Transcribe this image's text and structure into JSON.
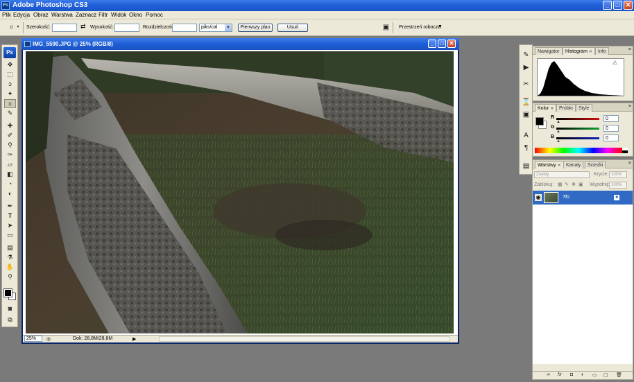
{
  "window": {
    "title": "Adobe Photoshop CS3"
  },
  "menu": [
    "Plik",
    "Edycja",
    "Obraz",
    "Warstwa",
    "Zaznacz",
    "Filtr",
    "Widok",
    "Okno",
    "Pomoc"
  ],
  "options": {
    "width_label": "Szerokość:",
    "width_value": "",
    "height_label": "Wysokość:",
    "height_value": "",
    "resolution_label": "Rozdzielczość:",
    "resolution_value": "",
    "resolution_unit": "piks/cal",
    "front_image_button": "Pierwszy plan",
    "clear_button": "Usuń",
    "workspace_label": "Przestrzeń robocza"
  },
  "document": {
    "title": "IMG_5590.JPG @ 25% (RGB/8)",
    "zoom": "25%",
    "doc_info": "Dok: 28,8M/28,8M"
  },
  "navigator_panel": {
    "tabs": [
      "Nawigator",
      "Histogram",
      "Info"
    ],
    "active_tab": "Histogram"
  },
  "color_panel": {
    "tabs": [
      "Kolor",
      "Próbki",
      "Style"
    ],
    "channels": [
      {
        "name": "R",
        "value": "0",
        "color": "#d01010"
      },
      {
        "name": "G",
        "value": "0",
        "color": "#10a030"
      },
      {
        "name": "B",
        "value": "0",
        "color": "#1020c0"
      }
    ]
  },
  "layers_panel": {
    "tabs": [
      "Warstwy",
      "Kanały",
      "Ścieżki"
    ],
    "blend_mode": "Zwykły",
    "opacity_label": "Krycie:",
    "opacity_value": "100%",
    "lock_label": "Zablokuj:",
    "fill_label": "Wypełnij:",
    "fill_value": "100%",
    "layers": [
      {
        "name": "Tło",
        "visible": true,
        "locked": true
      }
    ]
  },
  "colors": {
    "xp_blue": "#1f5fd8",
    "selection": "#316ac5",
    "panel_bg": "#ece9d8"
  }
}
